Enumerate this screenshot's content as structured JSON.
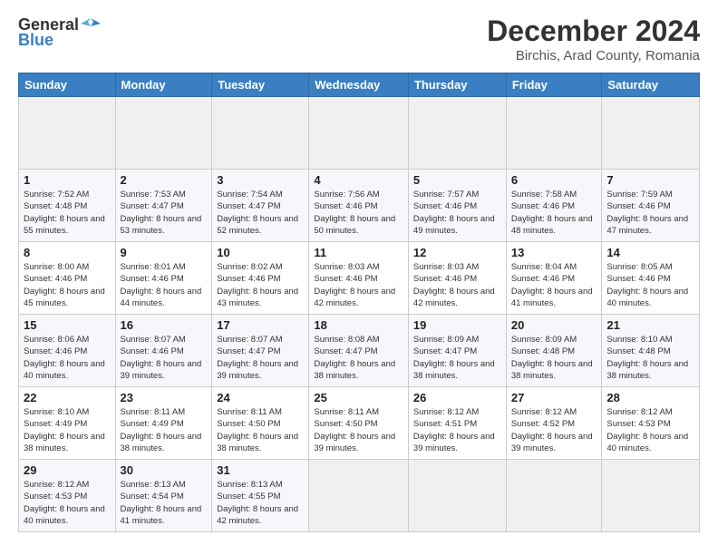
{
  "header": {
    "logo_line1": "General",
    "logo_line2": "Blue",
    "title": "December 2024",
    "subtitle": "Birchis, Arad County, Romania"
  },
  "calendar": {
    "days_of_week": [
      "Sunday",
      "Monday",
      "Tuesday",
      "Wednesday",
      "Thursday",
      "Friday",
      "Saturday"
    ],
    "weeks": [
      [
        null,
        null,
        null,
        null,
        null,
        null,
        null
      ],
      [
        {
          "day": "1",
          "sunrise": "7:52 AM",
          "sunset": "4:48 PM",
          "daylight": "8 hours and 55 minutes."
        },
        {
          "day": "2",
          "sunrise": "7:53 AM",
          "sunset": "4:47 PM",
          "daylight": "8 hours and 53 minutes."
        },
        {
          "day": "3",
          "sunrise": "7:54 AM",
          "sunset": "4:47 PM",
          "daylight": "8 hours and 52 minutes."
        },
        {
          "day": "4",
          "sunrise": "7:56 AM",
          "sunset": "4:46 PM",
          "daylight": "8 hours and 50 minutes."
        },
        {
          "day": "5",
          "sunrise": "7:57 AM",
          "sunset": "4:46 PM",
          "daylight": "8 hours and 49 minutes."
        },
        {
          "day": "6",
          "sunrise": "7:58 AM",
          "sunset": "4:46 PM",
          "daylight": "8 hours and 48 minutes."
        },
        {
          "day": "7",
          "sunrise": "7:59 AM",
          "sunset": "4:46 PM",
          "daylight": "8 hours and 47 minutes."
        }
      ],
      [
        {
          "day": "8",
          "sunrise": "8:00 AM",
          "sunset": "4:46 PM",
          "daylight": "8 hours and 45 minutes."
        },
        {
          "day": "9",
          "sunrise": "8:01 AM",
          "sunset": "4:46 PM",
          "daylight": "8 hours and 44 minutes."
        },
        {
          "day": "10",
          "sunrise": "8:02 AM",
          "sunset": "4:46 PM",
          "daylight": "8 hours and 43 minutes."
        },
        {
          "day": "11",
          "sunrise": "8:03 AM",
          "sunset": "4:46 PM",
          "daylight": "8 hours and 42 minutes."
        },
        {
          "day": "12",
          "sunrise": "8:03 AM",
          "sunset": "4:46 PM",
          "daylight": "8 hours and 42 minutes."
        },
        {
          "day": "13",
          "sunrise": "8:04 AM",
          "sunset": "4:46 PM",
          "daylight": "8 hours and 41 minutes."
        },
        {
          "day": "14",
          "sunrise": "8:05 AM",
          "sunset": "4:46 PM",
          "daylight": "8 hours and 40 minutes."
        }
      ],
      [
        {
          "day": "15",
          "sunrise": "8:06 AM",
          "sunset": "4:46 PM",
          "daylight": "8 hours and 40 minutes."
        },
        {
          "day": "16",
          "sunrise": "8:07 AM",
          "sunset": "4:46 PM",
          "daylight": "8 hours and 39 minutes."
        },
        {
          "day": "17",
          "sunrise": "8:07 AM",
          "sunset": "4:47 PM",
          "daylight": "8 hours and 39 minutes."
        },
        {
          "day": "18",
          "sunrise": "8:08 AM",
          "sunset": "4:47 PM",
          "daylight": "8 hours and 38 minutes."
        },
        {
          "day": "19",
          "sunrise": "8:09 AM",
          "sunset": "4:47 PM",
          "daylight": "8 hours and 38 minutes."
        },
        {
          "day": "20",
          "sunrise": "8:09 AM",
          "sunset": "4:48 PM",
          "daylight": "8 hours and 38 minutes."
        },
        {
          "day": "21",
          "sunrise": "8:10 AM",
          "sunset": "4:48 PM",
          "daylight": "8 hours and 38 minutes."
        }
      ],
      [
        {
          "day": "22",
          "sunrise": "8:10 AM",
          "sunset": "4:49 PM",
          "daylight": "8 hours and 38 minutes."
        },
        {
          "day": "23",
          "sunrise": "8:11 AM",
          "sunset": "4:49 PM",
          "daylight": "8 hours and 38 minutes."
        },
        {
          "day": "24",
          "sunrise": "8:11 AM",
          "sunset": "4:50 PM",
          "daylight": "8 hours and 38 minutes."
        },
        {
          "day": "25",
          "sunrise": "8:11 AM",
          "sunset": "4:50 PM",
          "daylight": "8 hours and 39 minutes."
        },
        {
          "day": "26",
          "sunrise": "8:12 AM",
          "sunset": "4:51 PM",
          "daylight": "8 hours and 39 minutes."
        },
        {
          "day": "27",
          "sunrise": "8:12 AM",
          "sunset": "4:52 PM",
          "daylight": "8 hours and 39 minutes."
        },
        {
          "day": "28",
          "sunrise": "8:12 AM",
          "sunset": "4:53 PM",
          "daylight": "8 hours and 40 minutes."
        }
      ],
      [
        {
          "day": "29",
          "sunrise": "8:12 AM",
          "sunset": "4:53 PM",
          "daylight": "8 hours and 40 minutes."
        },
        {
          "day": "30",
          "sunrise": "8:13 AM",
          "sunset": "4:54 PM",
          "daylight": "8 hours and 41 minutes."
        },
        {
          "day": "31",
          "sunrise": "8:13 AM",
          "sunset": "4:55 PM",
          "daylight": "8 hours and 42 minutes."
        },
        null,
        null,
        null,
        null
      ]
    ]
  }
}
